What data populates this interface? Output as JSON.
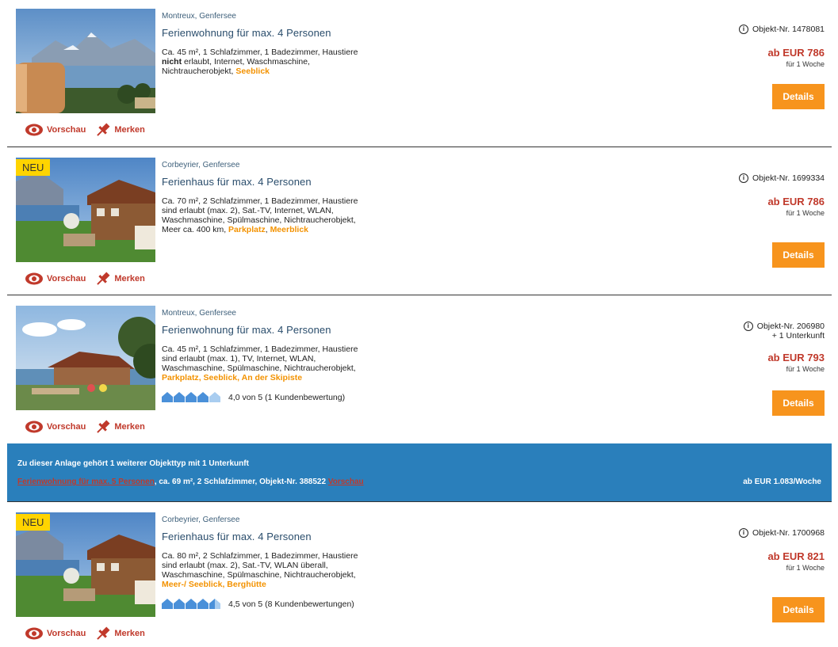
{
  "colors": {
    "accent": "#f7941d",
    "price": "#c0392b",
    "highlight": "#f39200",
    "banner": "#2a7fbb",
    "title": "#2a4d6c"
  },
  "actions": {
    "preview": "Vorschau",
    "save": "Merken"
  },
  "details_label": "Details",
  "listings": [
    {
      "location": "Montreux, Genfersee",
      "title": "Ferienwohnung für max. 4 Personen",
      "desc1": "Ca. 45 m², 1 Schlafzimmer, 1 Badezimmer, Haustiere",
      "desc2_bold": "nicht",
      "desc2": " erlaubt, Internet, Waschmaschine,",
      "desc3": "Nichtraucherobjekt, ",
      "highlight": "Seeblick",
      "objnr": "Objekt-Nr. 1478081",
      "price": "ab EUR 786",
      "per": "für 1 Woche"
    },
    {
      "badge": "NEU",
      "location": "Corbeyrier, Genfersee",
      "title": "Ferienhaus für max. 4 Personen",
      "desc1": "Ca. 70 m², 2 Schlafzimmer, 1 Badezimmer, Haustiere",
      "desc2": "sind erlaubt (max. 2), Sat.-TV, Internet, WLAN,",
      "desc3": "Waschmaschine, Spülmaschine, Nichtraucherobjekt,",
      "desc4": "Meer ca. 400 km, ",
      "highlight1": "Parkplatz",
      "highlight2": "Meerblick",
      "objnr": "Objekt-Nr. 1699334",
      "price": "ab EUR 786",
      "per": "für 1 Woche"
    },
    {
      "location": "Montreux, Genfersee",
      "title": "Ferienwohnung für max. 4 Personen",
      "desc1": "Ca. 45 m², 1 Schlafzimmer, 1 Badezimmer, Haustiere",
      "desc2": "sind erlaubt (max. 1), TV, Internet, WLAN,",
      "desc3": "Waschmaschine, Spülmaschine, Nichtraucherobjekt,",
      "highlight1": "Parkplatz",
      "highlight2": "Seeblick",
      "highlight3": "An der Skipiste",
      "rating_value": 4.0,
      "rating": "4,0 von 5 (1 Kundenbewertung)",
      "objnr": "Objekt-Nr. 206980",
      "extra": "+ 1 Unterkunft",
      "price": "ab EUR 793",
      "per": "für 1 Woche"
    },
    {
      "badge": "NEU",
      "location": "Corbeyrier, Genfersee",
      "title": "Ferienhaus für max. 4 Personen",
      "desc1": "Ca. 80 m², 2 Schlafzimmer, 1 Badezimmer, Haustiere",
      "desc2": "sind erlaubt (max. 2), Sat.-TV, WLAN überall,",
      "desc3": "Waschmaschine, Spülmaschine, Nichtraucherobjekt,",
      "highlight1": "Meer-/ Seeblick",
      "highlight2": "Berghütte",
      "rating_value": 4.5,
      "rating": "4,5 von 5 (8 Kundenbewertungen)",
      "objnr": "Objekt-Nr. 1700968",
      "price": "ab EUR 821",
      "per": "für 1 Woche"
    }
  ],
  "banner": {
    "title": "Zu dieser Anlage gehört 1 weiterer Objekttyp mit 1 Unterkunft",
    "link": "Ferienwohnung für max. 5 Personen",
    "info": ", ca. 69 m², 2 Schlafzimmer, Objekt-Nr. 388522 ",
    "preview": "Vorschau",
    "price": "ab EUR 1.083/Woche"
  }
}
